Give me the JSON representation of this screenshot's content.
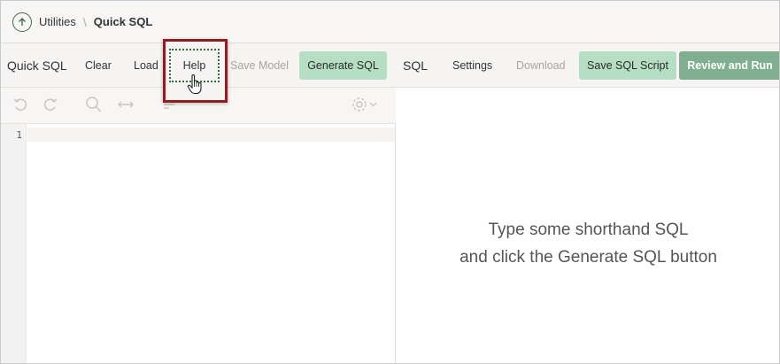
{
  "breadcrumb": {
    "up_icon": "arrow-up-circle-icon",
    "parent": "Utilities",
    "separator": "\\",
    "current": "Quick SQL"
  },
  "toolbar": {
    "left_title": "Quick SQL",
    "clear": "Clear",
    "load": "Load",
    "help": "Help",
    "save_model": "Save Model",
    "generate_sql": "Generate SQL",
    "right_title": "SQL",
    "settings": "Settings",
    "download": "Download",
    "save_sql_script": "Save SQL Script",
    "review_and_run": "Review and Run"
  },
  "editor": {
    "toolbar_icons": [
      "undo-icon",
      "redo-icon",
      "search-icon",
      "replace-icon",
      "format-icon",
      "settings-gear-icon"
    ],
    "line_numbers": [
      "1"
    ]
  },
  "output": {
    "placeholder_line1": "Type some shorthand SQL",
    "placeholder_line2": "and click the Generate SQL button"
  },
  "colors": {
    "highlight_border": "#8a1f24",
    "green_button": "#b5dec4",
    "primary_button": "#7faf8f"
  }
}
